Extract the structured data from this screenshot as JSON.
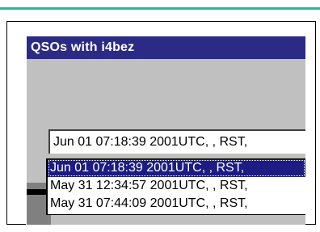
{
  "window": {
    "title": "QSOs with i4bez"
  },
  "combo": {
    "value": "Jun 01 07:18:39 2001UTC, , RST,"
  },
  "dropdown": {
    "items": [
      {
        "label": "Jun 01 07:18:39 2001UTC, , RST,",
        "selected": true
      },
      {
        "label": "May 31 12:34:57 2001UTC, , RST,",
        "selected": false
      },
      {
        "label": "May 31 07:44:09 2001UTC, , RST,",
        "selected": false
      }
    ]
  },
  "colors": {
    "accent": "#2bb59a",
    "titlebar": "#2b2b86",
    "selection": "#1c1c82",
    "window_face": "#c0c0c0"
  }
}
